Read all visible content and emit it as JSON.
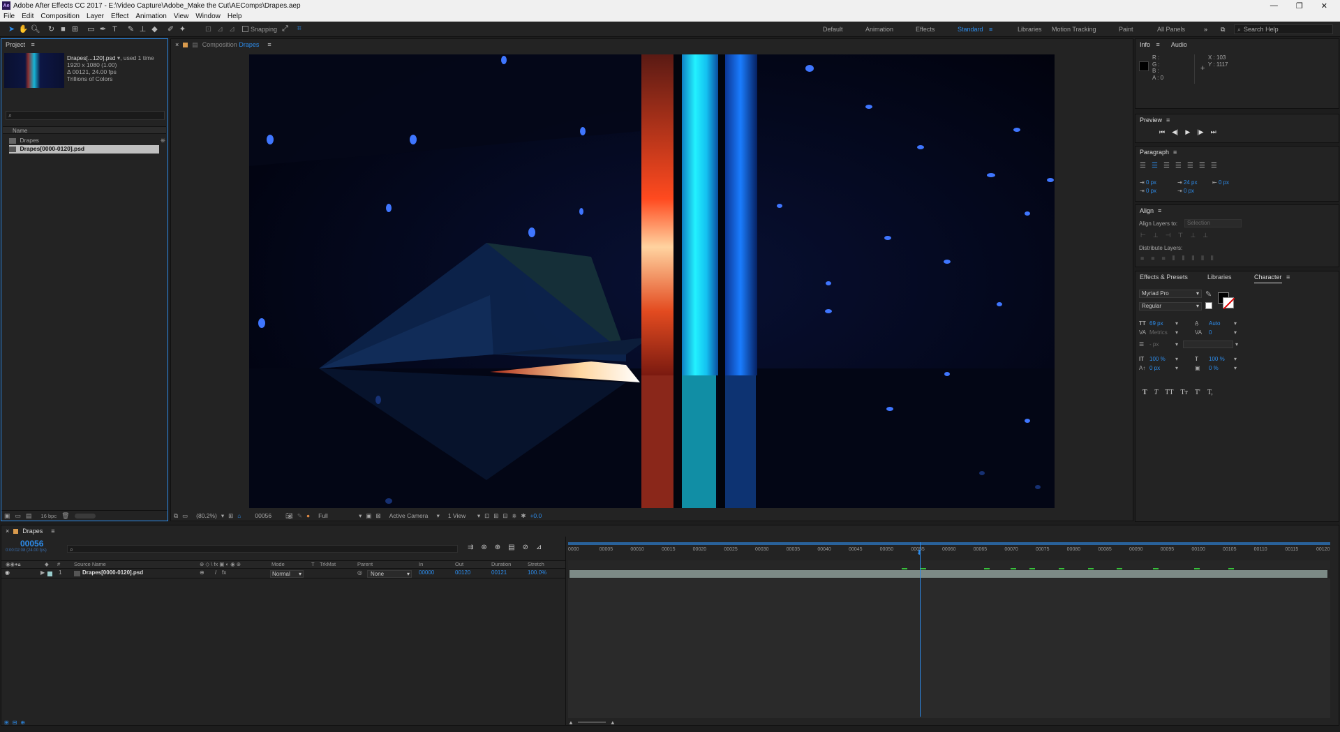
{
  "titlebar": {
    "title": "Adobe After Effects CC 2017 - E:\\Video Capture\\Adobe_Make the Cut\\AEComps\\Drapes.aep",
    "logo": "Ae",
    "min": "—",
    "restore": "❐",
    "close": "✕"
  },
  "menu": [
    "File",
    "Edit",
    "Composition",
    "Layer",
    "Effect",
    "Animation",
    "View",
    "Window",
    "Help"
  ],
  "toolbar": {
    "snapping": "Snapping",
    "workspaces": [
      "Default",
      "Animation",
      "Effects",
      "Standard",
      "Libraries",
      "Motion Tracking",
      "Paint",
      "All Panels"
    ],
    "active_workspace": "Standard",
    "search_placeholder": "Search Help"
  },
  "project": {
    "tab": "Project",
    "item_name": "Drapes[...120].psd",
    "item_used": ", used 1 time",
    "item_size": "1920 x 1080 (1.00)",
    "item_duration": "Δ 00121, 24.00 fps",
    "item_colors": "Trillions of Colors",
    "col_name": "Name",
    "items": [
      {
        "name": "Drapes",
        "icon": "composition-icon"
      },
      {
        "name": "Drapes[0000-0120].psd",
        "icon": "footage-icon",
        "selected": true
      }
    ],
    "bpc": "16 bpc"
  },
  "composition": {
    "tab_prefix": "Composition",
    "tab_name": "Drapes",
    "zoom": "(80.2%)",
    "frame": "00056",
    "resolution": "Full",
    "camera": "Active Camera",
    "views": "1 View",
    "exposure": "+0.0"
  },
  "info": {
    "tab": "Info",
    "tab2": "Audio",
    "r": "R :",
    "g": "G :",
    "b": "B :",
    "a": "A : 0",
    "x": "X : 103",
    "y": "Y : 1117"
  },
  "preview": {
    "tab": "Preview"
  },
  "paragraph": {
    "tab": "Paragraph",
    "indent_left": "0 px",
    "indent_first": "24 px",
    "indent_right": "0 px",
    "space_before": "0 px",
    "space_after": "0 px"
  },
  "align": {
    "tab": "Align",
    "align_to_label": "Align Layers to:",
    "align_to_value": "Selection",
    "distribute_label": "Distribute Layers:"
  },
  "character": {
    "tabs": [
      "Effects & Presets",
      "Libraries",
      "Character"
    ],
    "font": "Myriad Pro",
    "style": "Regular",
    "size": "69 px",
    "leading": "Auto",
    "kerning": "Metrics",
    "tracking": "0",
    "stroke": "- px",
    "vscale": "100 %",
    "hscale": "100 %",
    "baseline": "0 px",
    "tsume": "0 %",
    "styles": [
      "T",
      "T",
      "TT",
      "Tт",
      "T'",
      "T,"
    ]
  },
  "timeline": {
    "tab": "Drapes",
    "timecode": "00056",
    "timecode_sub": "0:00:02:08 (24.00 fps)",
    "headers": {
      "source": "Source Name",
      "mode": "Mode",
      "t": "T",
      "trkmat": "TrkMat",
      "parent": "Parent",
      "in": "In",
      "out": "Out",
      "duration": "Duration",
      "stretch": "Stretch"
    },
    "layer": {
      "num": "1",
      "name": "Drapes[0000-0120].psd",
      "mode": "Normal",
      "parent": "None",
      "in": "00000",
      "out": "00120",
      "duration": "00121",
      "stretch": "100.0%"
    },
    "ruler": [
      "0000",
      "00005",
      "00010",
      "00015",
      "00020",
      "00025",
      "00030",
      "00035",
      "00040",
      "00045",
      "00050",
      "00055",
      "00060",
      "00065",
      "00070",
      "00075",
      "00080",
      "00085",
      "00090",
      "00095",
      "00100",
      "00105",
      "00110",
      "00115",
      "00120"
    ]
  }
}
